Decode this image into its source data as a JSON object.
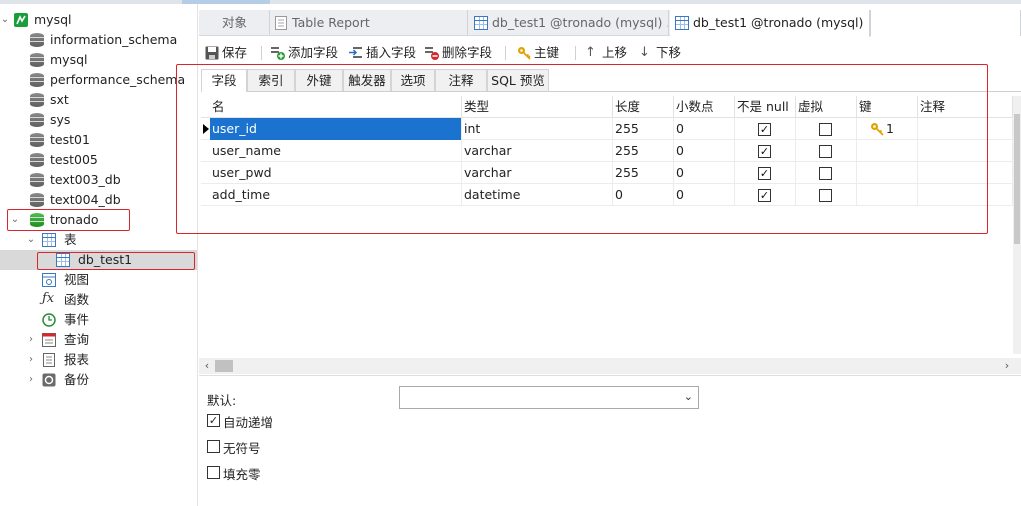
{
  "sidebar": {
    "items": [
      {
        "label": "mysql",
        "kind": "connection"
      },
      {
        "label": "information_schema",
        "kind": "database"
      },
      {
        "label": "mysql",
        "kind": "database"
      },
      {
        "label": "performance_schema",
        "kind": "database"
      },
      {
        "label": "sxt",
        "kind": "database"
      },
      {
        "label": "sys",
        "kind": "database"
      },
      {
        "label": "test01",
        "kind": "database"
      },
      {
        "label": "test005",
        "kind": "database"
      },
      {
        "label": "text003_db",
        "kind": "database"
      },
      {
        "label": "text004_db",
        "kind": "database"
      },
      {
        "label": "tronado",
        "kind": "database-open"
      },
      {
        "label": "表",
        "kind": "tables-folder"
      },
      {
        "label": "db_test1",
        "kind": "table"
      },
      {
        "label": "视图",
        "kind": "views"
      },
      {
        "label": "函数",
        "kind": "functions"
      },
      {
        "label": "事件",
        "kind": "events"
      },
      {
        "label": "查询",
        "kind": "queries"
      },
      {
        "label": "报表",
        "kind": "reports"
      },
      {
        "label": "备份",
        "kind": "backups"
      }
    ]
  },
  "tabs": [
    {
      "label": "对象"
    },
    {
      "label": "Table Report"
    },
    {
      "label": "db_test1 @tronado (mysql) ..."
    },
    {
      "label": "db_test1 @tronado (mysql)"
    }
  ],
  "toolbar": {
    "save": "保存",
    "add_field": "添加字段",
    "insert_field": "插入字段",
    "delete_field": "删除字段",
    "primary_key": "主键",
    "move_up": "上移",
    "move_down": "下移"
  },
  "inner_tabs": [
    "字段",
    "索引",
    "外键",
    "触发器",
    "选项",
    "注释",
    "SQL 预览"
  ],
  "grid": {
    "headers": [
      "名",
      "类型",
      "长度",
      "小数点",
      "不是 null",
      "虚拟",
      "键",
      "注释"
    ],
    "rows": [
      {
        "name": "user_id",
        "type": "int",
        "length": "255",
        "decimals": "0",
        "not_null": true,
        "virtual": false,
        "key": "1"
      },
      {
        "name": "user_name",
        "type": "varchar",
        "length": "255",
        "decimals": "0",
        "not_null": true,
        "virtual": false,
        "key": ""
      },
      {
        "name": "user_pwd",
        "type": "varchar",
        "length": "255",
        "decimals": "0",
        "not_null": true,
        "virtual": false,
        "key": ""
      },
      {
        "name": "add_time",
        "type": "datetime",
        "length": "0",
        "decimals": "0",
        "not_null": true,
        "virtual": false,
        "key": ""
      }
    ]
  },
  "properties": {
    "default_label": "默认:",
    "default_value": "",
    "auto_increment": "自动递增",
    "auto_increment_checked": true,
    "unsigned": "无符号",
    "unsigned_checked": false,
    "zerofill": "填充零",
    "zerofill_checked": false
  },
  "colors": {
    "selection": "#1b73cf",
    "highlight_box": "#d9262c",
    "key_icon": "#e0a400"
  }
}
